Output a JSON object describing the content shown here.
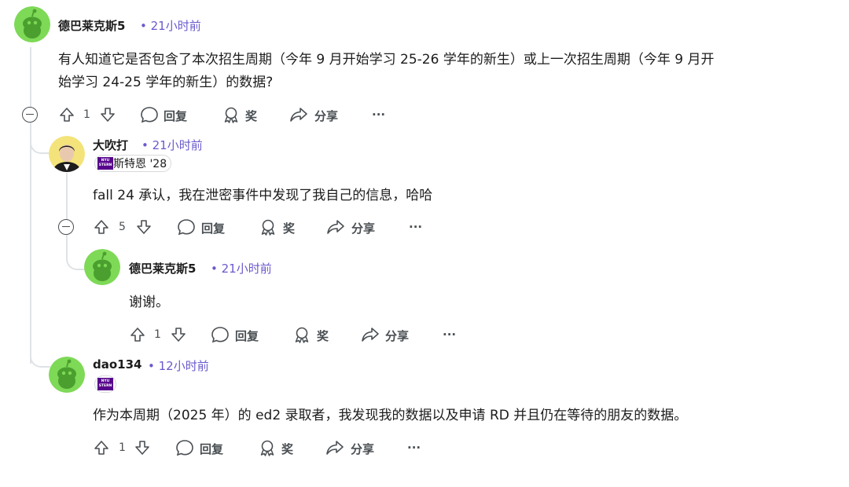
{
  "comments": [
    {
      "username": "德巴莱克斯5",
      "time": "• 21小时前",
      "body_line1": "有人知道它是否包含了本次招生周期（今年 9 月开始学习 25-26 学年的新生）或上一次招生周期（今年 9 月开",
      "body_line2": "始学习 24-25 学年的新生）的数据?",
      "votes": "1"
    },
    {
      "username": "大吹打",
      "time": "• 21小时前",
      "flair_text": "斯特恩 '28",
      "body_line1": "fall 24 承认，我在泄密事件中发现了我自己的信息，哈哈",
      "votes": "5"
    },
    {
      "username": "德巴莱克斯5",
      "time": "• 21小时前",
      "body_line1": "谢谢。",
      "votes": "1"
    },
    {
      "username": "dao134",
      "time": "• 12小时前",
      "flair_text": "",
      "body_line1": "作为本周期（2025 年）的 ed2 录取者，我发现我的数据以及申请 RD 并且仍在等待的朋友的数据。",
      "votes": "1"
    }
  ],
  "actions": {
    "reply": "回复",
    "award": "奖",
    "share": "分享",
    "more": "···"
  },
  "flair_logo": {
    "line1": "NYU",
    "line2": "STERN",
    "color": "#57068c"
  },
  "colors": {
    "time": "#6a5acd",
    "snoo_green": "#7ed957",
    "thread_line": "#dfe3e6"
  }
}
